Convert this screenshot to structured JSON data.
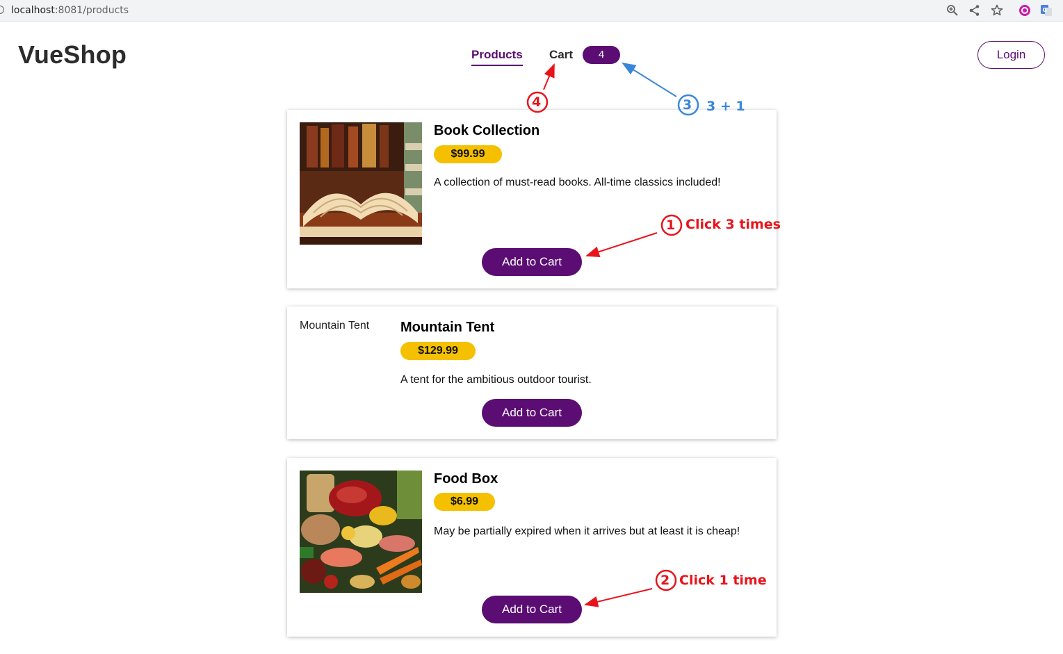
{
  "browser": {
    "url_host": "localhost",
    "url_rest": ":8081/products"
  },
  "header": {
    "logo": "VueShop",
    "nav_products": "Products",
    "nav_cart": "Cart",
    "cart_count": "4",
    "login": "Login"
  },
  "products": [
    {
      "title": "Book Collection",
      "price": "$99.99",
      "description": "A collection of must-read books. All-time classics included!",
      "button": "Add to Cart"
    },
    {
      "title": "Mountain Tent",
      "image_alt": "Mountain Tent",
      "price": "$129.99",
      "description": "A tent for the ambitious outdoor tourist.",
      "button": "Add to Cart"
    },
    {
      "title": "Food Box",
      "price": "$6.99",
      "description": "May be partially expired when it arrives but at least it is cheap!",
      "button": "Add to Cart"
    }
  ],
  "annotations": {
    "step1_num": "1",
    "step1_text": "Click 3 times",
    "step2_num": "2",
    "step2_text": "Click 1 time",
    "step3_num": "3",
    "step3_text": "3 + 1",
    "step4_num": "4",
    "red": "#e8141b",
    "blue": "#3a87d9"
  },
  "colors": {
    "brand_purple": "#5b0d73",
    "price_yellow": "#f5c000"
  }
}
